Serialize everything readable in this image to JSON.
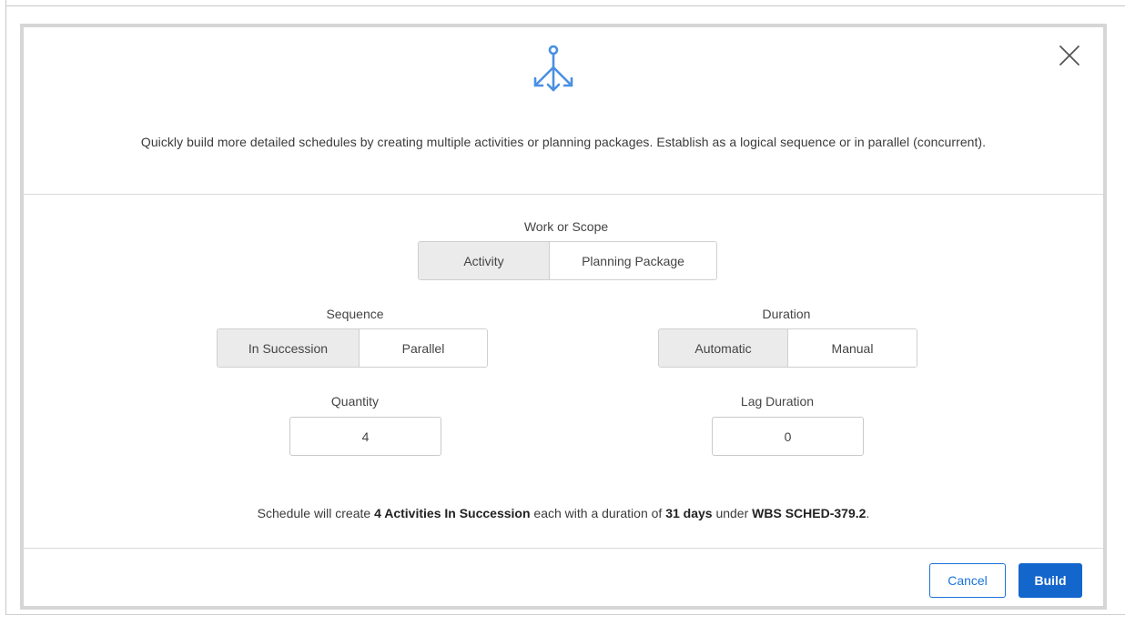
{
  "colors": {
    "accent": "#1366cc",
    "icon": "#4a90e2",
    "selected_segment": "#ebebeb"
  },
  "header": {
    "icon_name": "branch-split-icon",
    "close_icon_name": "close-icon",
    "description": "Quickly build more detailed schedules by creating multiple activities or planning packages. Establish as a logical sequence or in parallel (concurrent)."
  },
  "work_scope": {
    "label": "Work or Scope",
    "options": [
      "Activity",
      "Planning Package"
    ],
    "selected": "Activity"
  },
  "sequence": {
    "label": "Sequence",
    "options": [
      "In Succession",
      "Parallel"
    ],
    "selected": "In Succession"
  },
  "duration": {
    "label": "Duration",
    "options": [
      "Automatic",
      "Manual"
    ],
    "selected": "Automatic"
  },
  "quantity": {
    "label": "Quantity",
    "value": "4"
  },
  "lag_duration": {
    "label": "Lag Duration",
    "value": "0"
  },
  "summary": {
    "prefix": "Schedule will create ",
    "count_type": "4 Activities In Succession",
    "mid": " each with a duration of ",
    "days": "31 days",
    "under": " under ",
    "wbs": "WBS SCHED-379.2",
    "suffix": "."
  },
  "footer": {
    "cancel_label": "Cancel",
    "build_label": "Build"
  }
}
